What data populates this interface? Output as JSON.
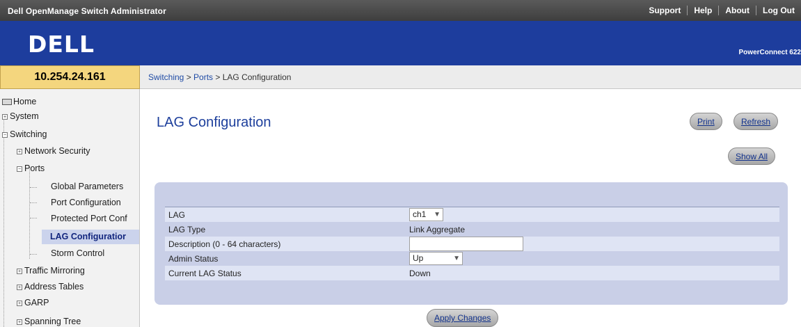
{
  "header": {
    "app_title": "Dell OpenManage Switch Administrator",
    "links": [
      "Support",
      "Help",
      "About",
      "Log Out"
    ],
    "logo": "DELL",
    "product": "PowerConnect 622"
  },
  "ip_address": "10.254.24.161",
  "breadcrumb": {
    "items": [
      "Switching",
      "Ports"
    ],
    "separator": " > ",
    "current": "LAG Configuration"
  },
  "nav": {
    "home": "Home",
    "system": "System",
    "switching": "Switching",
    "network_security": "Network Security",
    "ports": "Ports",
    "global_parameters": "Global Parameters",
    "port_configuration": "Port Configuration",
    "protected_port": "Protected Port Conf",
    "lag_configuration": "LAG Configuratior",
    "storm_control": "Storm Control",
    "traffic_mirroring": "Traffic Mirroring",
    "address_tables": "Address Tables",
    "garp": "GARP",
    "spanning_tree": "Spanning Tree"
  },
  "page": {
    "title": "LAG Configuration",
    "print_label": "Print",
    "refresh_label": "Refresh",
    "show_all_label": "Show All",
    "apply_label": "Apply Changes"
  },
  "form": {
    "lag_label": "LAG",
    "lag_value": "ch1",
    "lag_type_label": "LAG Type",
    "lag_type_value": "Link Aggregate",
    "description_label": "Description (0 - 64 characters)",
    "description_value": "",
    "admin_status_label": "Admin Status",
    "admin_status_value": "Up",
    "current_status_label": "Current LAG Status",
    "current_status_value": "Down"
  }
}
